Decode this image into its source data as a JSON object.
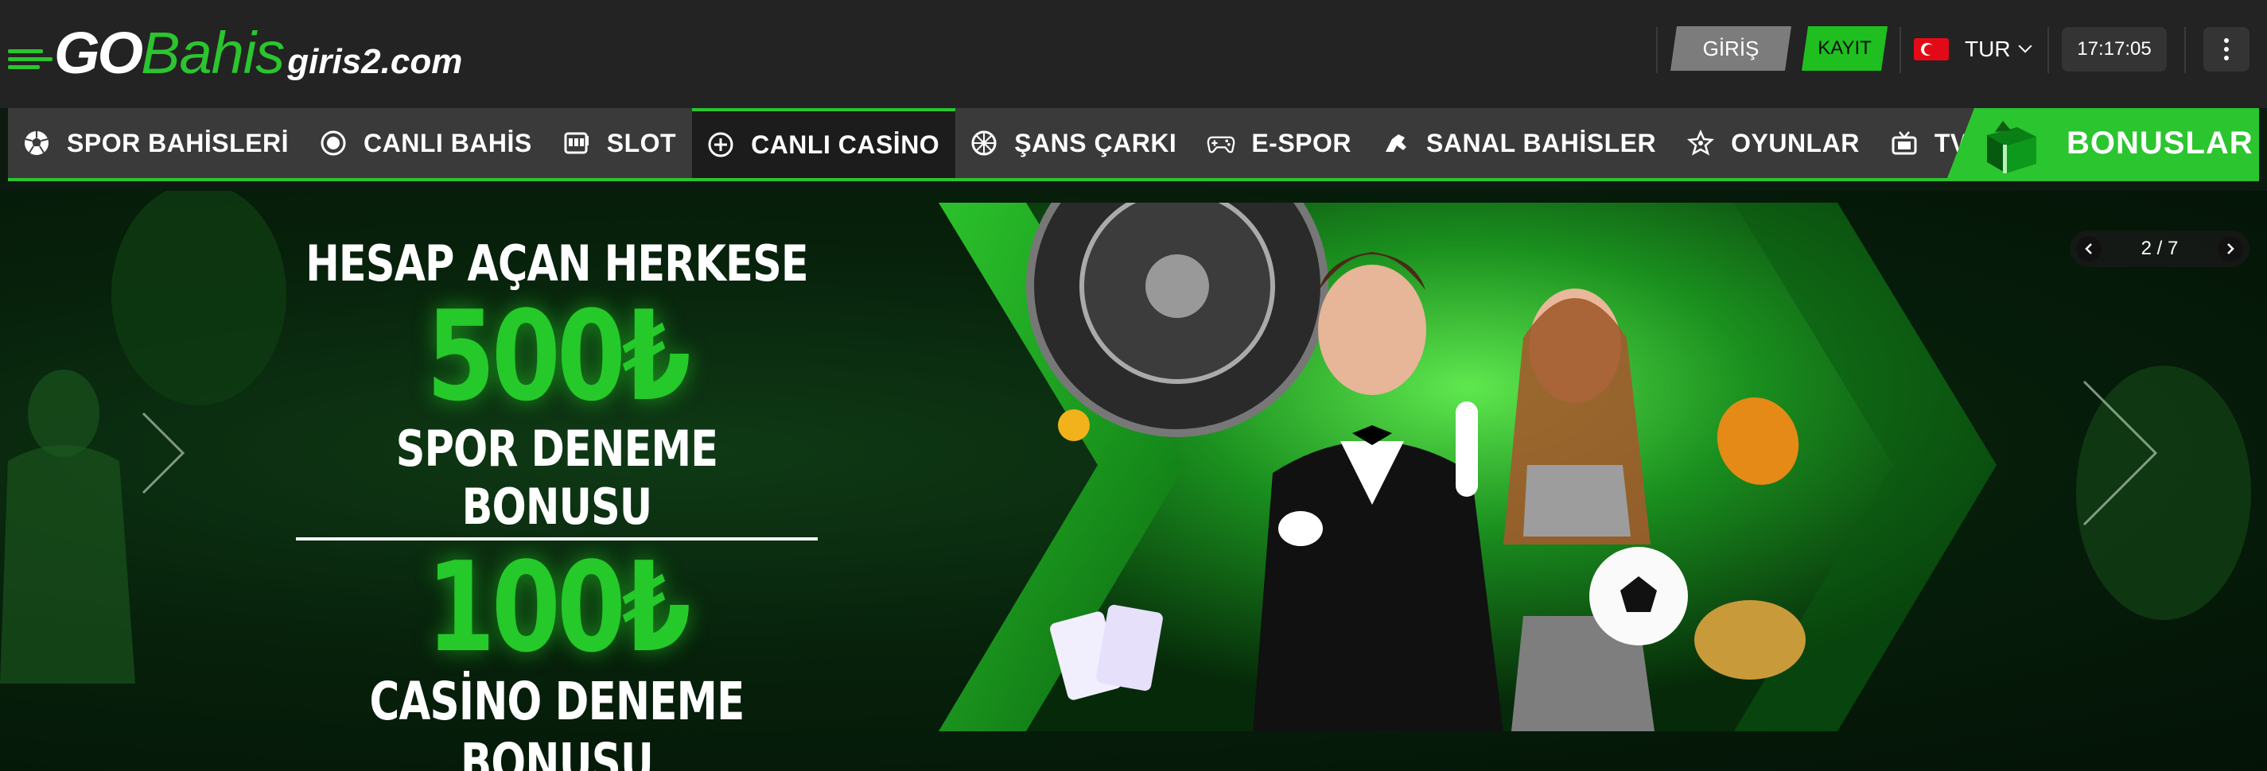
{
  "header": {
    "logo": {
      "go": "GO",
      "bahis": "Bahis",
      "domain": "giris2.com"
    },
    "login_label": "GİRİŞ",
    "register_label": "KAYIT",
    "language": "TUR",
    "clock": "17:17:05",
    "icons": {
      "flag": "turkey-flag-icon",
      "menu": "kebab-menu-icon"
    }
  },
  "nav": {
    "items": [
      {
        "label": "SPOR BAHİSLERİ",
        "icon": "soccer-ball-icon"
      },
      {
        "label": "CANLI BAHİS",
        "icon": "live-dot-icon"
      },
      {
        "label": "SLOT",
        "icon": "slot-machine-icon"
      },
      {
        "label": "CANLI CASİNO",
        "icon": "casino-chip-icon",
        "active": true
      },
      {
        "label": "ŞANS ÇARKI",
        "icon": "wheel-icon"
      },
      {
        "label": "E-SPOR",
        "icon": "gamepad-icon"
      },
      {
        "label": "SANAL BAHİSLER",
        "icon": "virtual-racing-icon"
      },
      {
        "label": "OYUNLAR",
        "icon": "games-icon"
      },
      {
        "label": "TV OYUNLARI",
        "icon": "tv-icon"
      }
    ],
    "bonus_label": "BONUSLAR"
  },
  "banner": {
    "line1": "HESAP AÇAN HERKESE",
    "line2": "500₺",
    "line3": "SPOR DENEME BONUSU",
    "line4": "100₺",
    "line5": "CASİNO DENEME BONUSU",
    "pager": "2 / 7"
  },
  "colors": {
    "accent": "#2bc52f",
    "header_bg": "#232323",
    "nav_bg": "#3a3a3a"
  }
}
